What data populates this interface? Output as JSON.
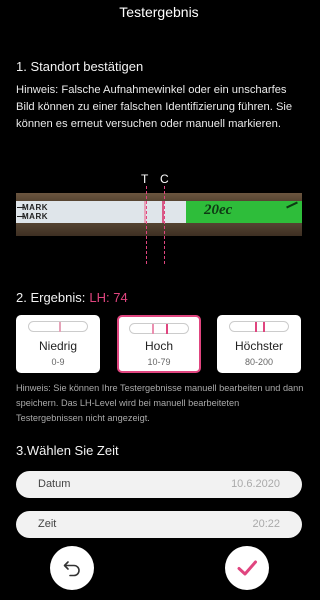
{
  "header": {
    "title": "Testergebnis"
  },
  "section1": {
    "title": "1. Standort bestätigen",
    "hint": "Hinweis: Falsche Aufnahmewinkel oder ein unscharfes Bild können zu einer falschen Identifizierung führen. Sie können es erneut versuchen oder manuell markieren.",
    "marker_t": "T",
    "marker_c": "C",
    "strip_mark_1": "MARK",
    "strip_mark_2": "MARK",
    "strip_text": "20ec"
  },
  "section2": {
    "title": "2. Ergebnis:",
    "lh_value": "LH: 74",
    "options": [
      {
        "label": "Niedrig",
        "range": "0-9"
      },
      {
        "label": "Hoch",
        "range": "10-79"
      },
      {
        "label": "Höchster",
        "range": "80-200"
      }
    ],
    "hint": "Hinweis: Sie können Ihre Testergebnisse manuell bearbeiten und dann speichern. Das LH-Level wird bei manuell bearbeiteten Testergebnissen nicht angezeigt."
  },
  "section3": {
    "title": "3.Wählen Sie Zeit",
    "date_label": "Datum",
    "date_value": "10.6.2020",
    "time_label": "Zeit",
    "time_value": "20:22"
  },
  "actions": {
    "back_icon": "undo-icon",
    "confirm_icon": "check-icon"
  },
  "colors": {
    "accent": "#e0457f",
    "background": "#000000"
  }
}
